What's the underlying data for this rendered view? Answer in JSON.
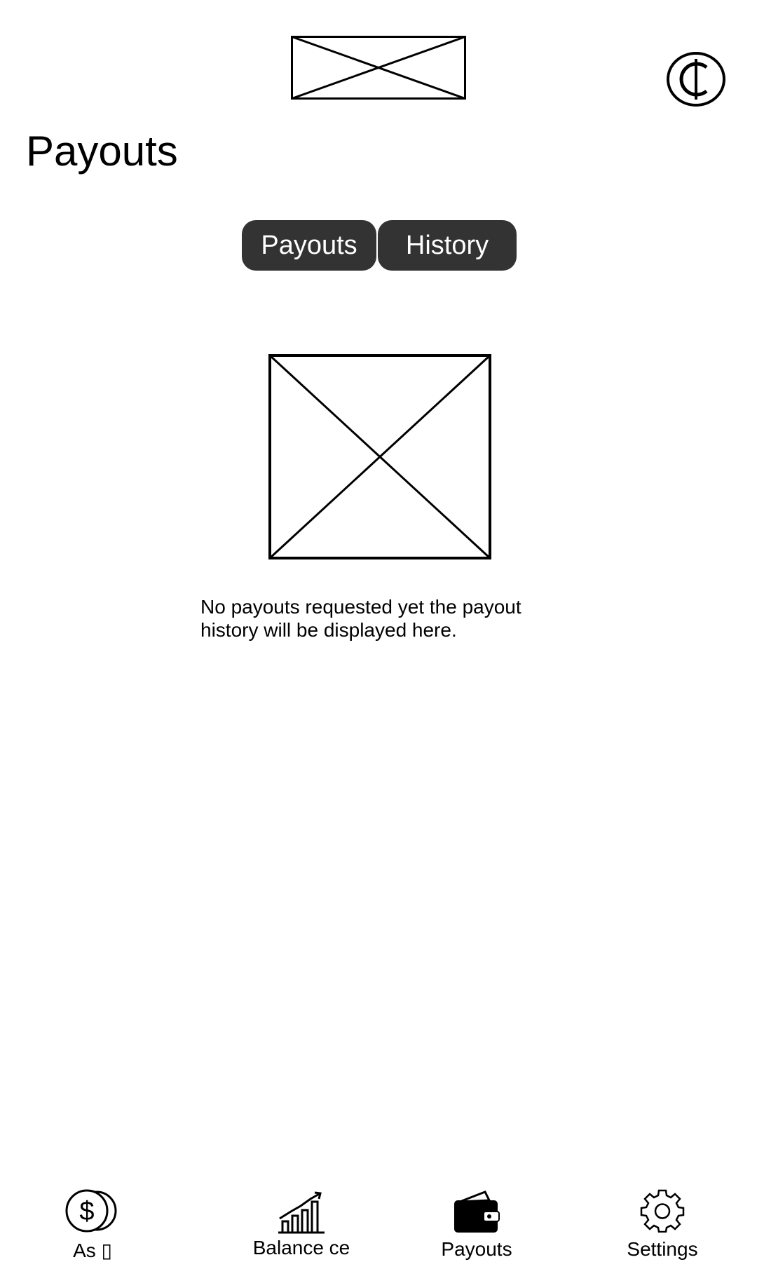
{
  "header": {
    "currency_icon": "cedi-icon"
  },
  "page": {
    "title": "Payouts"
  },
  "tabs": [
    {
      "label": "Payouts",
      "selected": true
    },
    {
      "label": "History",
      "selected": false
    }
  ],
  "empty_state": {
    "message": "No payouts requested yet the payout history will be displayed here."
  },
  "bottom_nav": {
    "items": [
      {
        "label": "As ▯",
        "icon": "coins-dollar-icon"
      },
      {
        "label": "Balance ce",
        "icon": "growth-chart-icon"
      },
      {
        "label": "Payouts",
        "icon": "wallet-icon",
        "active": true
      },
      {
        "label": "Settings",
        "icon": "gear-icon"
      }
    ]
  },
  "colors": {
    "tab_background": "#333333",
    "tab_text": "#ffffff",
    "background": "#ffffff",
    "text": "#000000"
  }
}
